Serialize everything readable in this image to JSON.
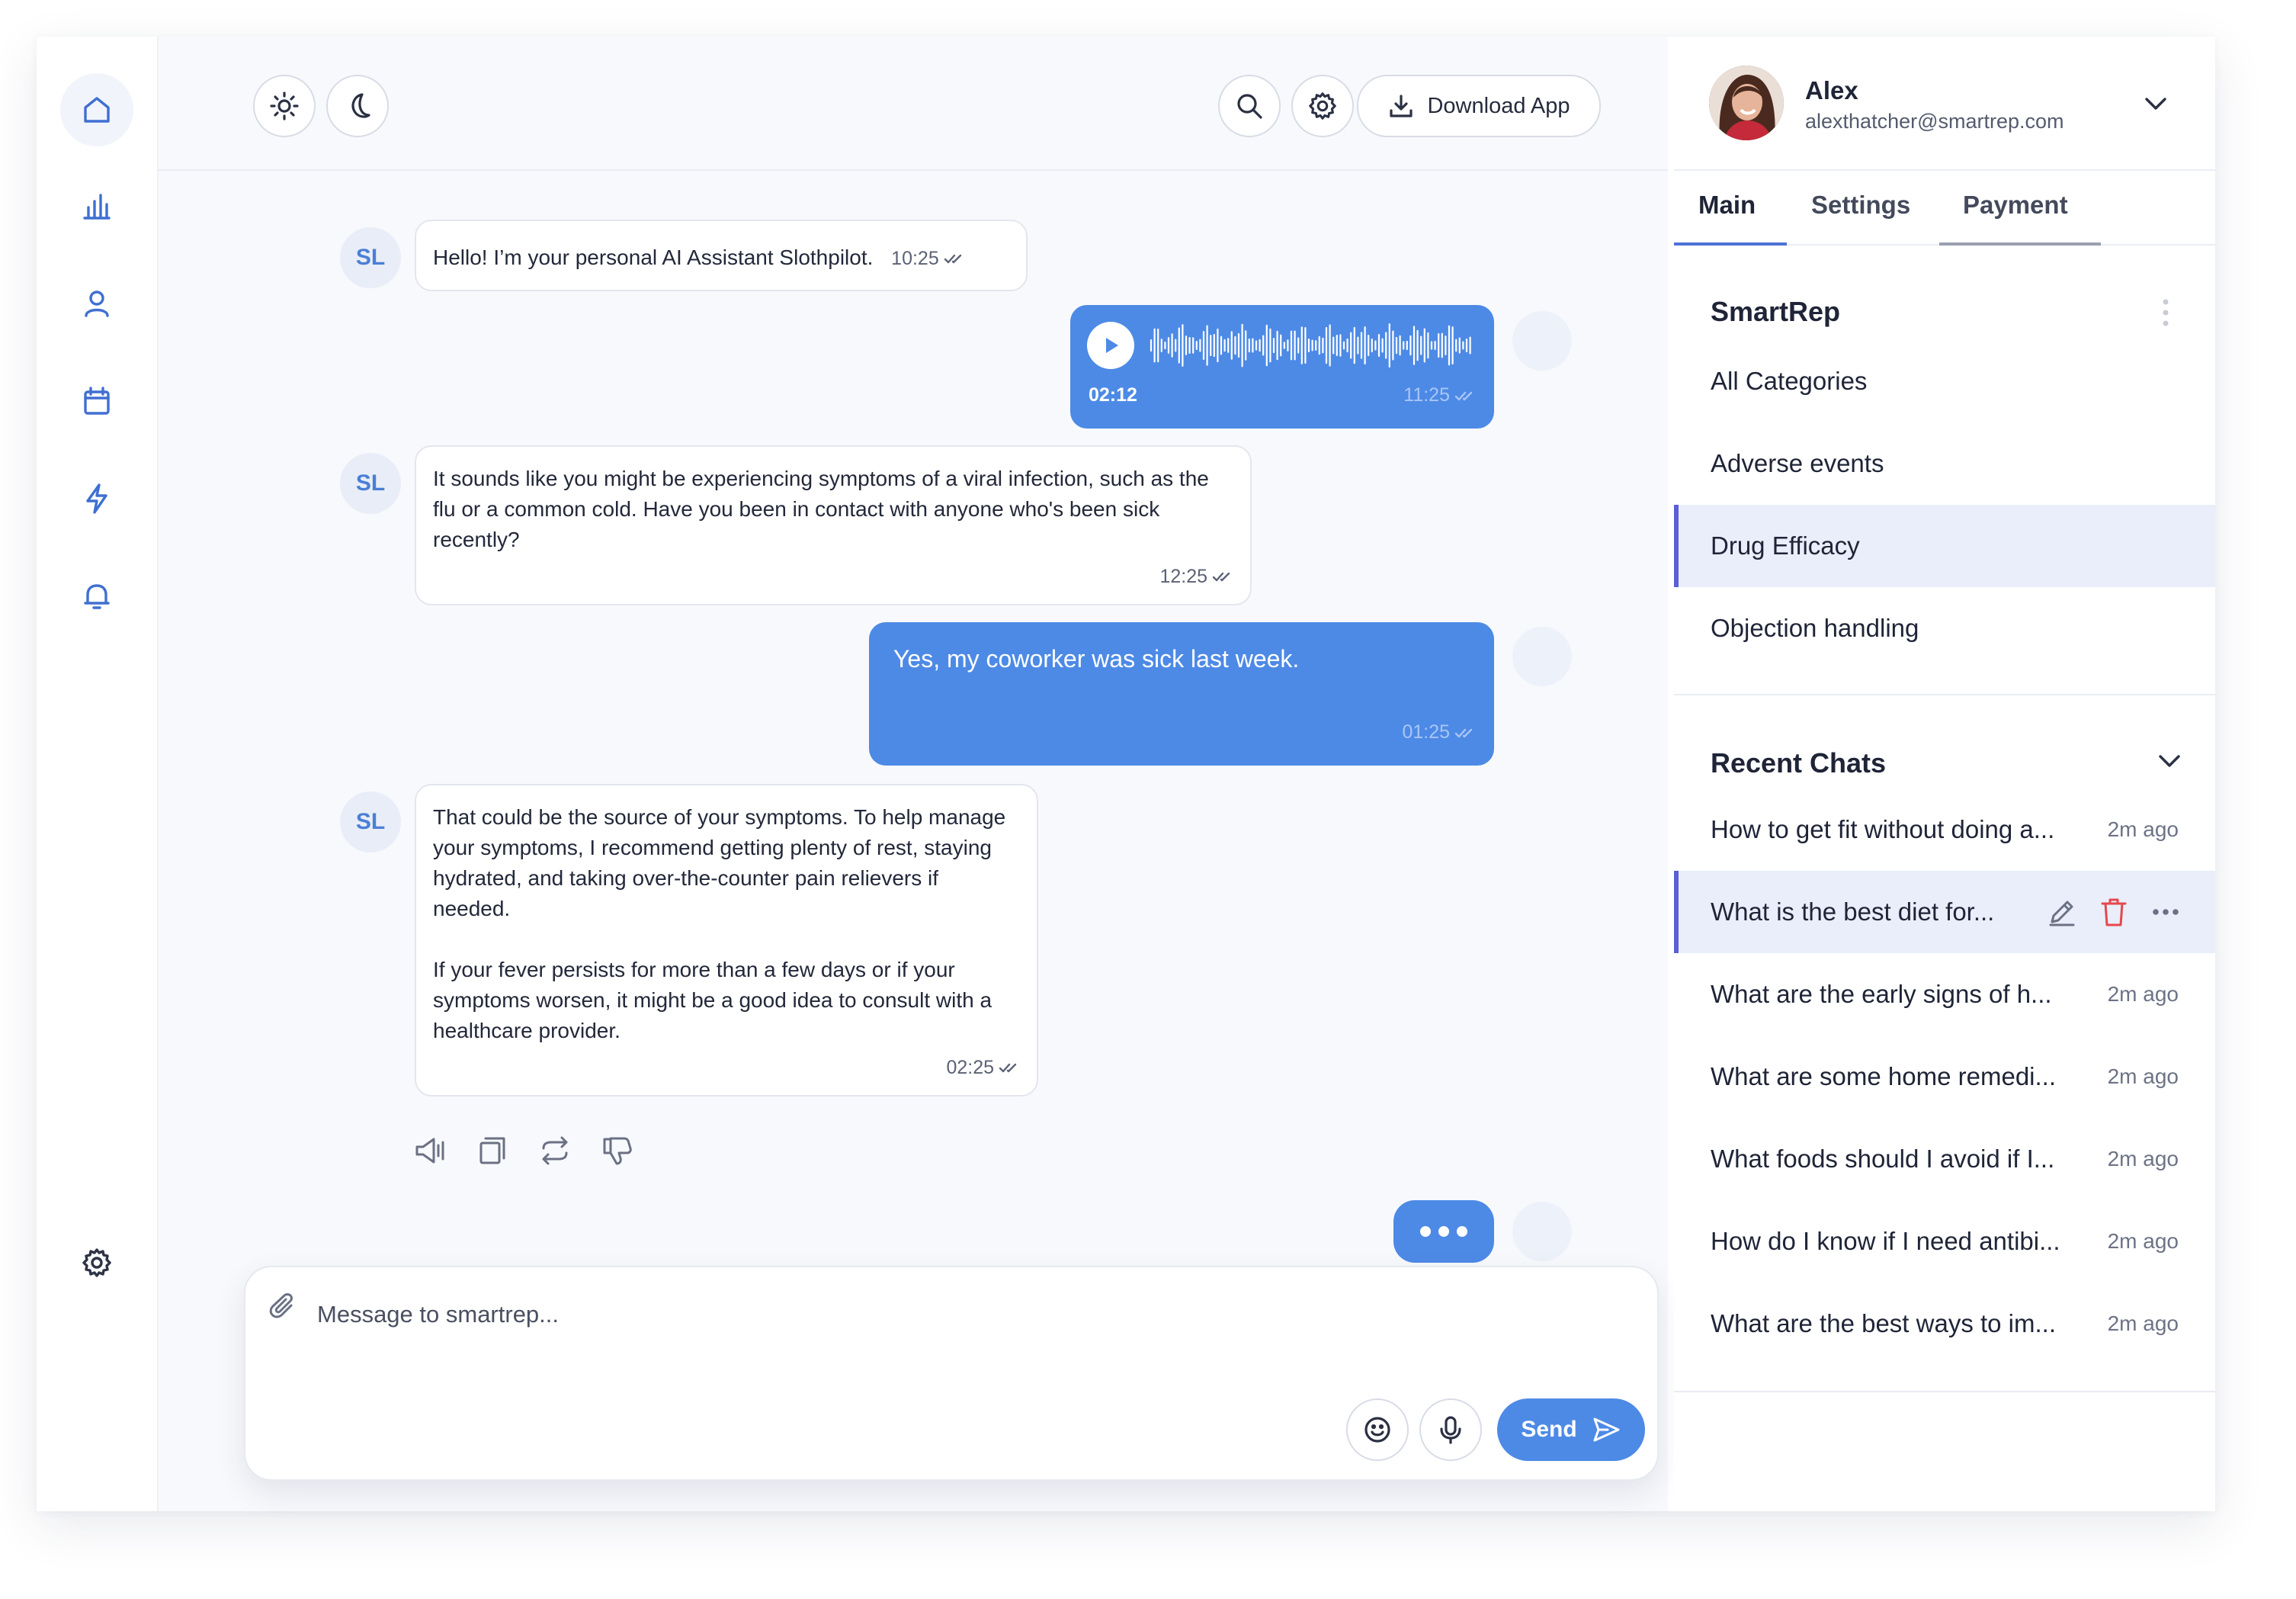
{
  "rail": {
    "items": [
      "home",
      "analytics",
      "profile",
      "calendar",
      "lightning",
      "notifications"
    ],
    "bottom": "settings"
  },
  "topbar": {
    "download_label": "Download App"
  },
  "messages": {
    "m1": {
      "avatar": "SL",
      "text": "Hello! I’m your personal AI Assistant Slothpilot.",
      "time": "10:25"
    },
    "m2": {
      "duration": "02:12",
      "time": "11:25"
    },
    "m3": {
      "avatar": "SL",
      "text": "It sounds like you might be experiencing symptoms of a viral infection, such as the flu or a common cold. Have you been in contact with anyone who's been sick recently?",
      "time": "12:25"
    },
    "m4": {
      "text": "Yes, my coworker was sick last week.",
      "time": "01:25"
    },
    "m5": {
      "avatar": "SL",
      "p1": "That could be the source of your symptoms. To help manage your symptoms, I recommend getting plenty of rest, staying hydrated, and taking over-the-counter pain relievers if needed.",
      "p2": "If your fever persists for more than a few days or if your symptoms worsen, it might be a good idea to consult with a healthcare provider.",
      "time": "02:25"
    }
  },
  "composer": {
    "placeholder": "Message to smartrep...",
    "send_label": "Send"
  },
  "profile": {
    "name": "Alex",
    "email": "alexthatcher@smartrep.com"
  },
  "tabs": [
    "Main",
    "Settings",
    "Payment"
  ],
  "smartrep": {
    "title": "SmartRep",
    "categories": [
      "All Categories",
      "Adverse events",
      "Drug Efficacy",
      "Objection handling"
    ]
  },
  "recent": {
    "title": "Recent Chats",
    "chats": [
      {
        "title": "How to get fit without doing a...",
        "ago": "2m ago"
      },
      {
        "title": "What is the best diet for...",
        "ago": ""
      },
      {
        "title": "What are the early signs of h...",
        "ago": "2m ago"
      },
      {
        "title": "What are some home remedi...",
        "ago": "2m ago"
      },
      {
        "title": "What foods should I avoid if I...",
        "ago": "2m ago"
      },
      {
        "title": "How do I know if I need antibi...",
        "ago": "2m ago"
      },
      {
        "title": "What are the best ways to im...",
        "ago": "2m ago"
      }
    ]
  },
  "colors": {
    "accent": "#4d8ae6",
    "selected_bar": "#5b5fd6",
    "danger": "#e5484d"
  }
}
